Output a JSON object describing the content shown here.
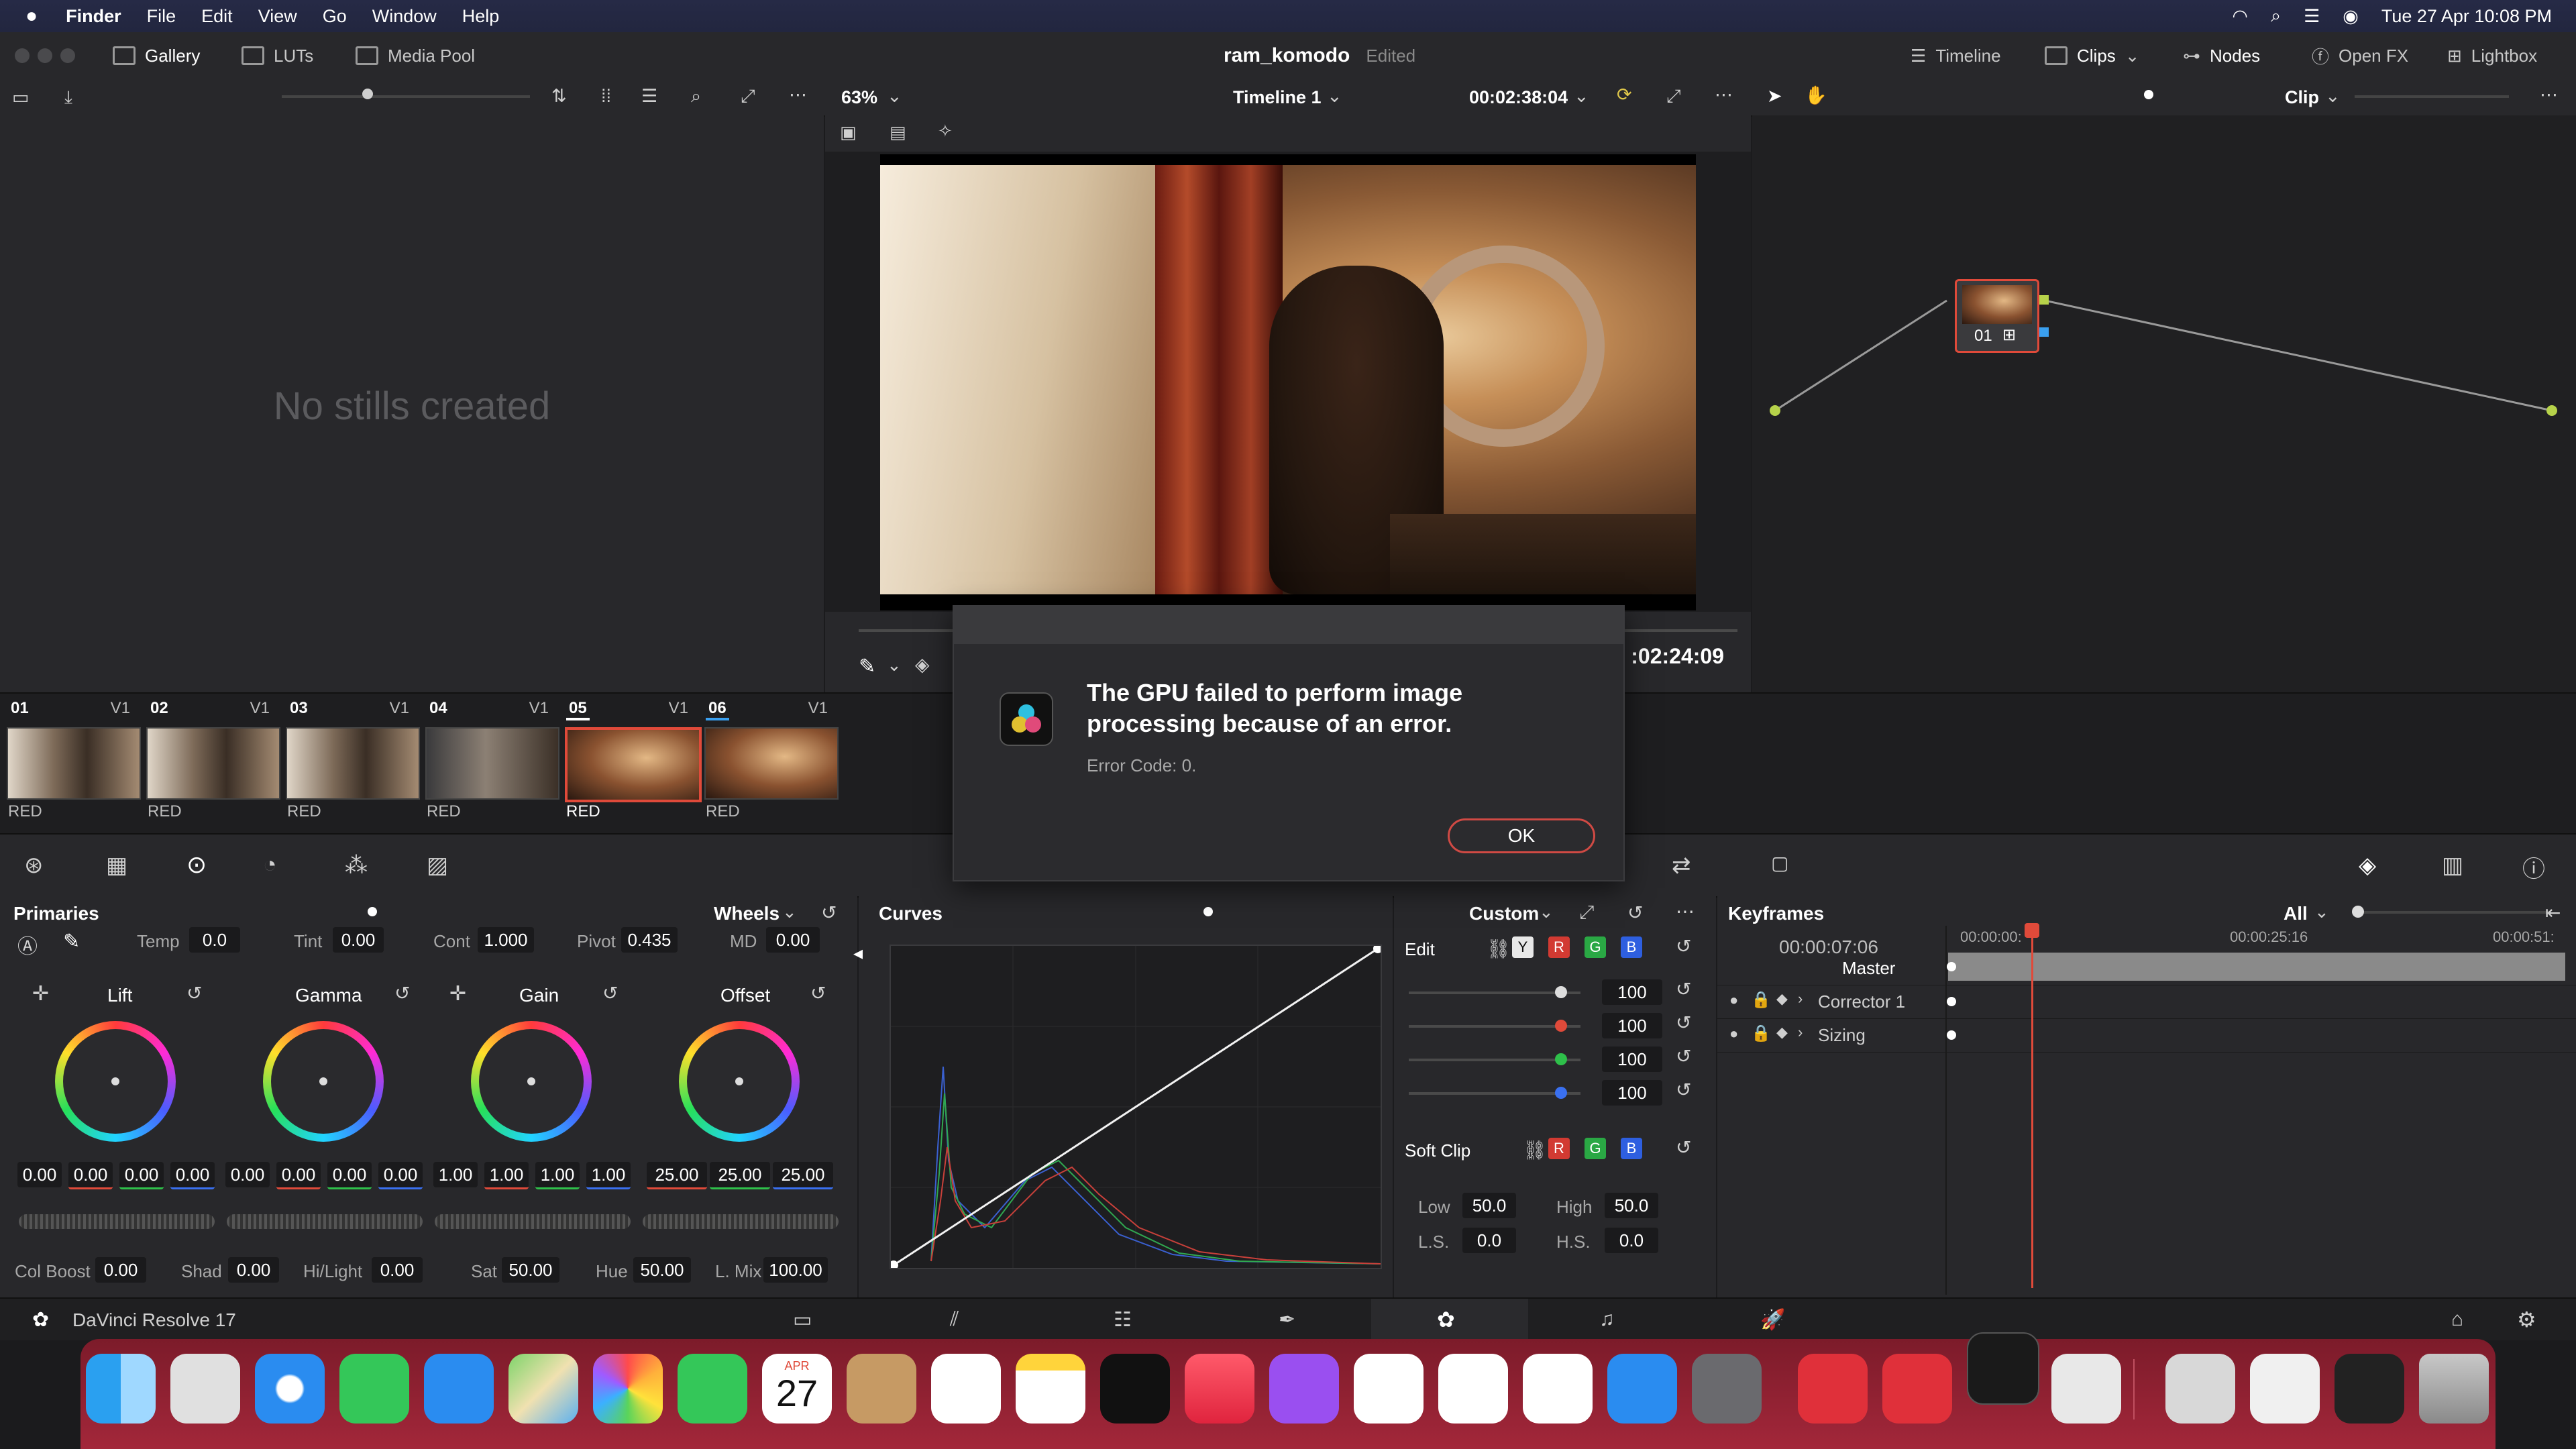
{
  "menubar": {
    "app": "Finder",
    "items": [
      "File",
      "Edit",
      "View",
      "Go",
      "Window",
      "Help"
    ],
    "datetime": "Tue 27 Apr  10:08 PM"
  },
  "toolbar": {
    "gallery": "Gallery",
    "luts": "LUTs",
    "media_pool": "Media Pool",
    "project_name": "ram_komodo",
    "project_status": "Edited",
    "timeline": "Timeline",
    "clips": "Clips",
    "nodes": "Nodes",
    "open_fx": "Open FX",
    "lightbox": "Lightbox"
  },
  "viewer": {
    "zoom": "63%",
    "timeline_name": "Timeline 1",
    "timecode": "00:02:38:04",
    "timecode2": ":02:24:09",
    "clip_mode": "Clip"
  },
  "gallery": {
    "empty": "No stills created"
  },
  "nodes": {
    "node_label": "01"
  },
  "clips": [
    {
      "num": "01",
      "track": "V1",
      "label": "RED"
    },
    {
      "num": "02",
      "track": "V1",
      "label": "RED"
    },
    {
      "num": "03",
      "track": "V1",
      "label": "RED"
    },
    {
      "num": "04",
      "track": "V1",
      "label": "RED"
    },
    {
      "num": "05",
      "track": "V1",
      "label": "RED"
    },
    {
      "num": "06",
      "track": "V1",
      "label": "RED"
    }
  ],
  "primaries": {
    "title": "Primaries",
    "mode": "Wheels",
    "temp_label": "Temp",
    "temp": "0.0",
    "tint_label": "Tint",
    "tint": "0.00",
    "cont_label": "Cont",
    "cont": "1.000",
    "pivot_label": "Pivot",
    "pivot": "0.435",
    "md_label": "MD",
    "md": "0.00",
    "wheels": [
      {
        "name": "Lift",
        "values": [
          "0.00",
          "0.00",
          "0.00",
          "0.00"
        ]
      },
      {
        "name": "Gamma",
        "values": [
          "0.00",
          "0.00",
          "0.00",
          "0.00"
        ]
      },
      {
        "name": "Gain",
        "values": [
          "1.00",
          "1.00",
          "1.00",
          "1.00"
        ]
      },
      {
        "name": "Offset",
        "values": [
          "25.00",
          "25.00",
          "25.00"
        ]
      }
    ],
    "col_boost_label": "Col Boost",
    "col_boost": "0.00",
    "shad_label": "Shad",
    "shad": "0.00",
    "hilight_label": "Hi/Light",
    "hilight": "0.00",
    "sat_label": "Sat",
    "sat": "50.00",
    "hue_label": "Hue",
    "hue": "50.00",
    "lmix_label": "L. Mix",
    "lmix": "100.00"
  },
  "curves": {
    "title": "Curves",
    "mode": "Custom",
    "edit_label": "Edit",
    "channel_values": [
      "100",
      "100",
      "100",
      "100"
    ],
    "soft_clip_label": "Soft Clip",
    "low_label": "Low",
    "low": "50.0",
    "high_label": "High",
    "high": "50.0",
    "ls_label": "L.S.",
    "ls": "0.0",
    "hs_label": "H.S.",
    "hs": "0.0",
    "chips": {
      "y": "Y",
      "r": "R",
      "g": "G",
      "b": "B"
    }
  },
  "keyframes": {
    "title": "Keyframes",
    "filter": "All",
    "current_tc": "00:00:07:06",
    "tick1": "00:00:00:",
    "tick2": "00:00:25:16",
    "tick3": "00:00:51:",
    "rows": [
      "Master",
      "Corrector 1",
      "Sizing"
    ]
  },
  "status": {
    "app": "DaVinci Resolve 17"
  },
  "dialog": {
    "title": "The GPU failed to perform image processing because of an error.",
    "code": "Error Code: 0.",
    "ok": "OK"
  },
  "dock": {
    "calendar_month": "APR",
    "calendar_day": "27"
  },
  "colors": {
    "accent_red": "#e04a3a",
    "dock_bg": "#a3273a",
    "menubar_bg": "#262a46"
  }
}
